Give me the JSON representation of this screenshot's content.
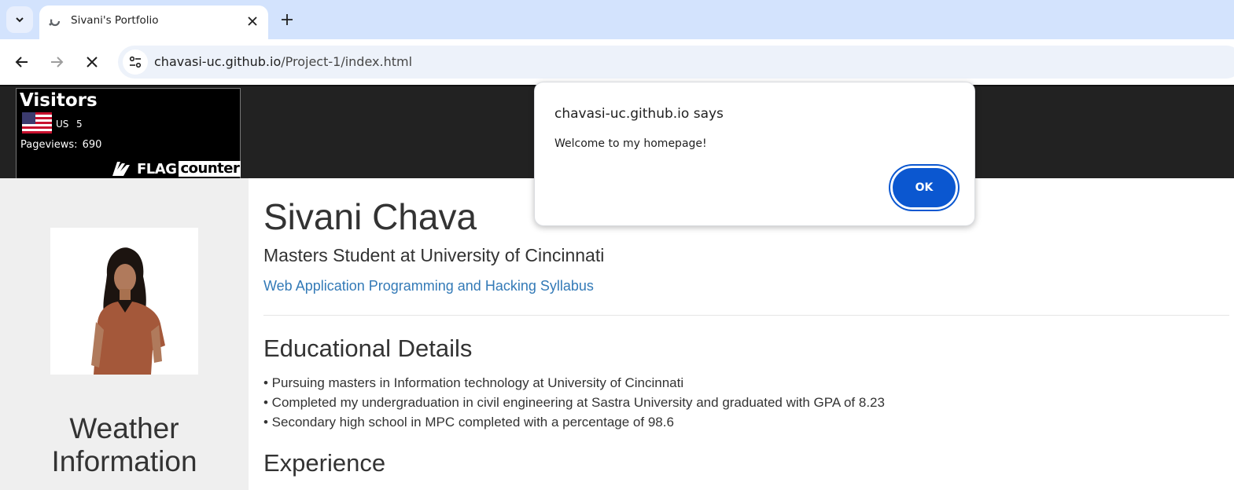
{
  "browser": {
    "tab_title": "Sivani's Portfolio",
    "url_host": "chavasi-uc.github.io",
    "url_path": "/Project-1/index.html"
  },
  "flag_counter": {
    "title": "Visitors",
    "country": "US",
    "count": "5",
    "pageviews_label": "Pageviews:",
    "pageviews_value": "690",
    "logo_flag": "FLAG",
    "logo_counter": "counter"
  },
  "sidebar": {
    "weather_title": "Weather Information"
  },
  "main": {
    "name": "Sivani Chava",
    "subtitle": "Masters Student at University of Cincinnati",
    "syllabus_link": "Web Application Programming and Hacking Syllabus",
    "education_heading": "Educational Details",
    "education_items": [
      "• Pursuing masters in Information technology at University of Cincinnati",
      "• Completed my undergraduation in civil engineering at Sastra University and graduated with GPA of 8.23",
      "• Secondary high school in MPC completed with a percentage of 98.6"
    ],
    "experience_heading": "Experience"
  },
  "dialog": {
    "title": "chavasi-uc.github.io says",
    "message": "Welcome to my homepage!",
    "ok_label": "OK"
  },
  "colors": {
    "tabstrip": "#d3e3fd",
    "omnibox": "#edf2fa",
    "header_band": "#222222",
    "link": "#337ab7",
    "ok_button": "#0b57d0"
  }
}
